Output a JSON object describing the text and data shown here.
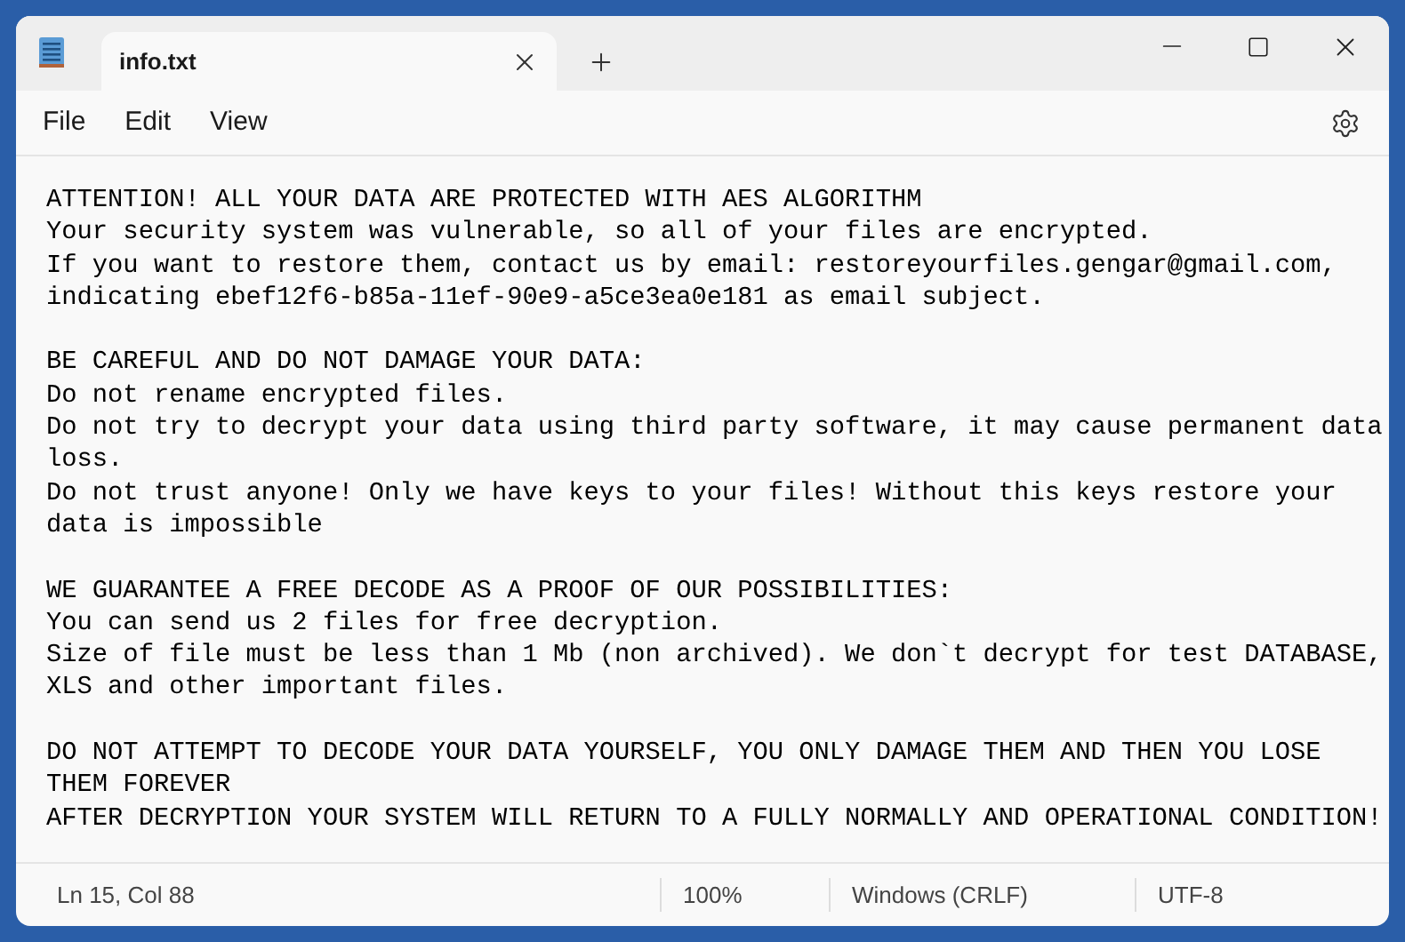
{
  "tab": {
    "title": "info.txt",
    "selected": true
  },
  "menu": [
    "File",
    "Edit",
    "View"
  ],
  "paragraphs": [
    [
      "ATTENTION! ALL YOUR DATA ARE PROTECTED WITH AES ALGORITHM",
      "Your security system was vulnerable, so all of your files are encrypted.",
      "If you want to restore them, contact us by email: restoreyourfiles.gengar@gmail.com,",
      "indicating ebef12f6-b85a-11ef-90e9-a5ce3ea0e181 as email subject."
    ],
    [
      "BE CAREFUL AND DO NOT DAMAGE YOUR DATA:",
      "Do not rename encrypted files.",
      "Do not try to decrypt your data using third party software, it may cause permanent data",
      "loss.",
      "Do not trust anyone! Only we have keys to your files! Without this keys restore your",
      "data is impossible"
    ],
    [
      "WE GUARANTEE A FREE DECODE AS A PROOF OF OUR POSSIBILITIES:",
      "You can send us 2 files for free decryption.",
      "Size of file must be less than 1 Mb (non archived). We don`t decrypt for test DATABASE,",
      "XLS and other important files."
    ],
    [
      "DO NOT ATTEMPT TO DECODE YOUR DATA YOURSELF, YOU ONLY DAMAGE THEM AND THEN YOU LOSE",
      "THEM FOREVER",
      "AFTER DECRYPTION YOUR SYSTEM WILL RETURN TO A FULLY NORMALLY AND OPERATIONAL CONDITION!"
    ]
  ],
  "status_bar": {
    "position": "Ln 15, Col 88",
    "zoom": "100%",
    "line_ending": "Windows (CRLF)",
    "encoding": "UTF-8"
  }
}
